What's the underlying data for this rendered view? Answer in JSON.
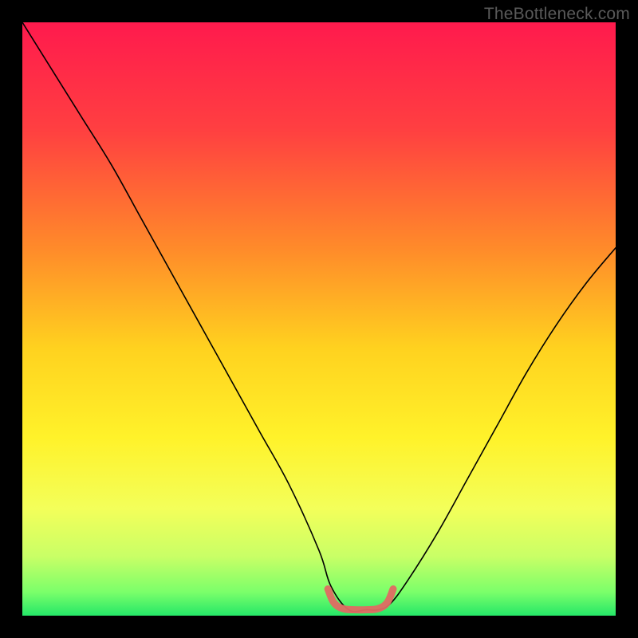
{
  "watermark": "TheBottleneck.com",
  "chart_data": {
    "type": "line",
    "title": "",
    "xlabel": "",
    "ylabel": "",
    "xlim": [
      0,
      100
    ],
    "ylim": [
      0,
      100
    ],
    "background_gradient": {
      "stops": [
        {
          "offset": 0,
          "color": "#ff1a4d"
        },
        {
          "offset": 18,
          "color": "#ff3f41"
        },
        {
          "offset": 38,
          "color": "#ff8a2a"
        },
        {
          "offset": 55,
          "color": "#ffd21f"
        },
        {
          "offset": 70,
          "color": "#fff22a"
        },
        {
          "offset": 82,
          "color": "#f3ff5a"
        },
        {
          "offset": 90,
          "color": "#c9ff66"
        },
        {
          "offset": 96,
          "color": "#7bff6a"
        },
        {
          "offset": 100,
          "color": "#25e768"
        }
      ]
    },
    "series": [
      {
        "name": "bottleneck-curve",
        "color": "#000000",
        "stroke_width": 1.6,
        "x": [
          0,
          5,
          10,
          15,
          20,
          25,
          30,
          35,
          40,
          45,
          50,
          52,
          55,
          58,
          60,
          62,
          65,
          70,
          75,
          80,
          85,
          90,
          95,
          100
        ],
        "y": [
          100,
          92,
          84,
          76,
          67,
          58,
          49,
          40,
          31,
          22,
          11,
          5,
          1,
          1,
          1,
          2,
          6,
          14,
          23,
          32,
          41,
          49,
          56,
          62
        ]
      }
    ],
    "highlight_segment": {
      "name": "trough-highlight",
      "color": "#e06a63",
      "stroke_width": 9,
      "x": [
        51.5,
        52.5,
        54,
        56,
        58,
        60,
        61.5,
        62.5
      ],
      "y": [
        4.5,
        2.2,
        1.2,
        1.0,
        1.0,
        1.2,
        2.2,
        4.5
      ]
    }
  }
}
